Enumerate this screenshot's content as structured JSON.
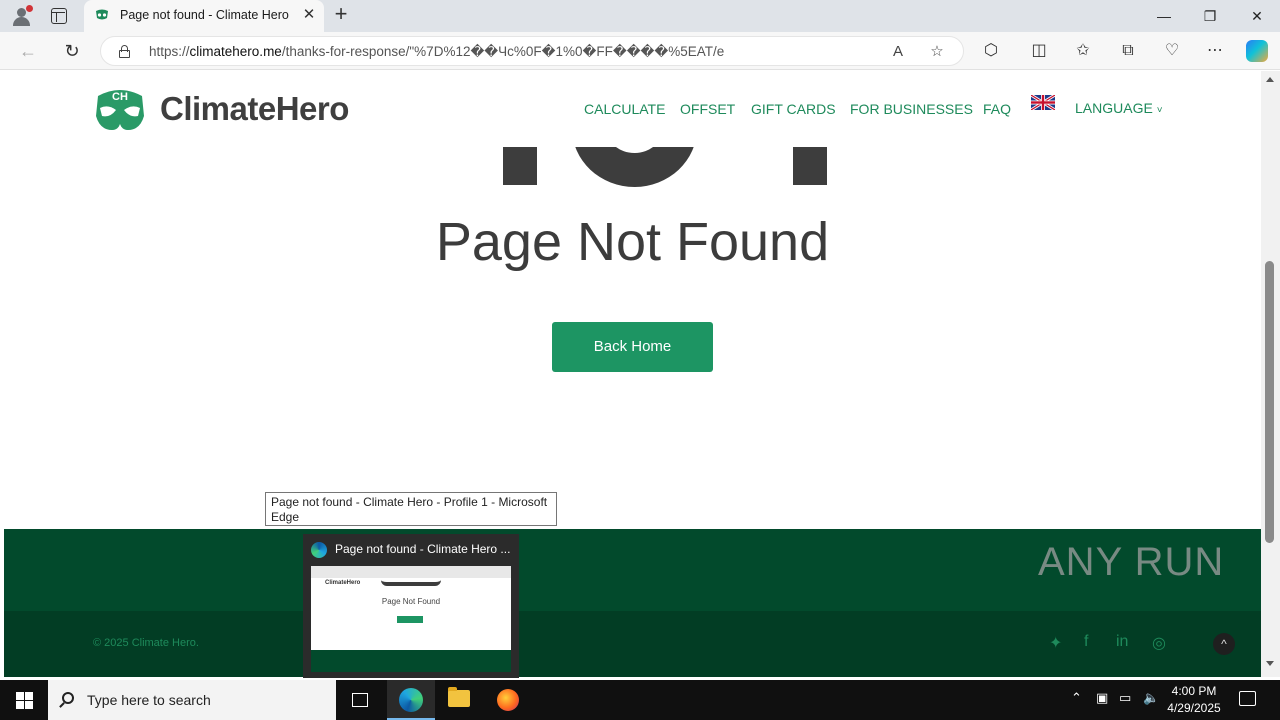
{
  "browser": {
    "tab_title": "Page not found - Climate Hero",
    "tab_close": "✕",
    "new_tab": "+",
    "url_prefix": "https://",
    "url_host": "climatehero.me",
    "url_path": "/thanks-for-response/\"%7D%12��Чc%0F�1%0�FF����%5EAT/e",
    "minimize": "—",
    "restore": "❐",
    "close": "✕"
  },
  "site": {
    "logo_text": "ClimateHero",
    "logo_letters": "CH",
    "nav": [
      {
        "label": "CALCULATE"
      },
      {
        "label": "OFFSET"
      },
      {
        "label": "GIFT CARDS"
      },
      {
        "label": "FOR BUSINESSES"
      },
      {
        "label": "FAQ"
      }
    ],
    "language_label": "LANGUAGE",
    "language_caret": "˅"
  },
  "main": {
    "title": "Page Not Found",
    "back_home_label": "Back Home"
  },
  "footer": {
    "copyright": "© 2025 Climate Hero.",
    "back_to_top": "^"
  },
  "overlays": {
    "tooltip": "Page not found - Climate Hero - Profile 1 - Microsoft Edge",
    "preview_title": "Page not found - Climate Hero ...",
    "preview_logo": "ClimateHero",
    "preview_page_title": "Page Not Found",
    "watermark": "ANY RUN"
  },
  "taskbar": {
    "search_placeholder": "Type here to search",
    "time": "4:00 PM",
    "date": "4/29/2025"
  },
  "colors": {
    "brand_green": "#1e8a5b",
    "button_green": "#1d9563",
    "footer_green": "#024a2c"
  }
}
